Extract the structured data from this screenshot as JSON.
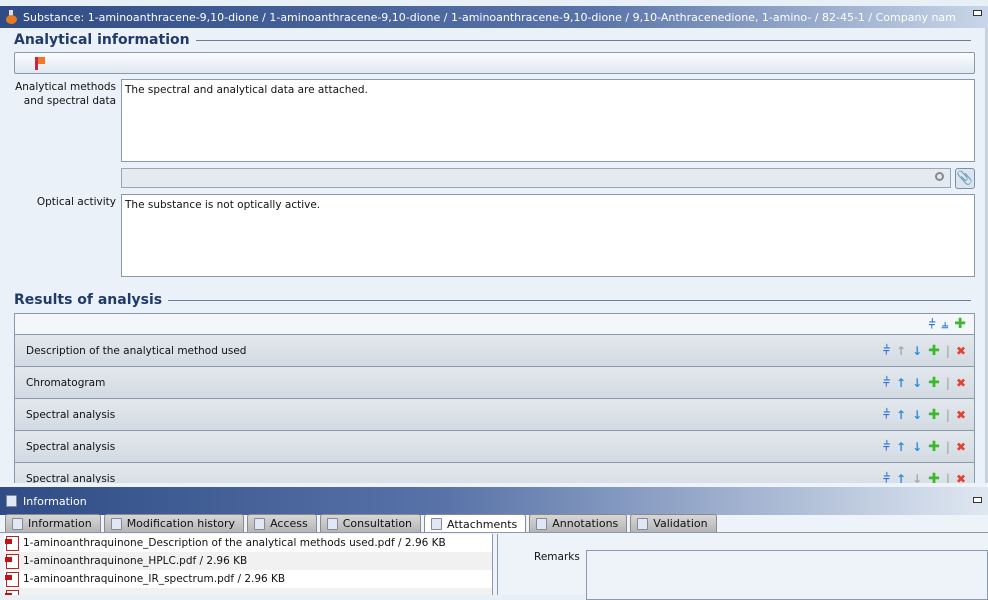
{
  "window": {
    "title": "Substance: 1-aminoanthracene-9,10-dione / 1-aminoanthracene-9,10-dione / 1-aminoanthracene-9,10-dione / 9,10-Anthracenedione, 1-amino- / 82-45-1 / Company nam"
  },
  "analytical": {
    "heading": "Analytical information",
    "methods_label": "Analytical methods and spectral data",
    "methods_value": "The spectral and analytical data are attached.",
    "optical_label": "Optical activity",
    "optical_value": "The substance is not optically active."
  },
  "results": {
    "heading": "Results of analysis",
    "rows": [
      {
        "label": "Description of the analytical method used"
      },
      {
        "label": "Chromatogram"
      },
      {
        "label": "Spectral analysis"
      },
      {
        "label": "Spectral analysis"
      },
      {
        "label": "Spectral analysis"
      }
    ]
  },
  "info": {
    "title": "Information",
    "tabs": [
      "Information",
      "Modification history",
      "Access",
      "Consultation",
      "Attachments",
      "Annotations",
      "Validation"
    ],
    "active_tab": "Attachments",
    "attachments": [
      "1-aminoanthraquinone_Description of the analytical methods used.pdf / 2.96 KB",
      "1-aminoanthraquinone_HPLC.pdf / 2.96 KB",
      "1-aminoanthraquinone_IR_spectrum.pdf / 2.96 KB"
    ],
    "remarks_label": "Remarks"
  }
}
